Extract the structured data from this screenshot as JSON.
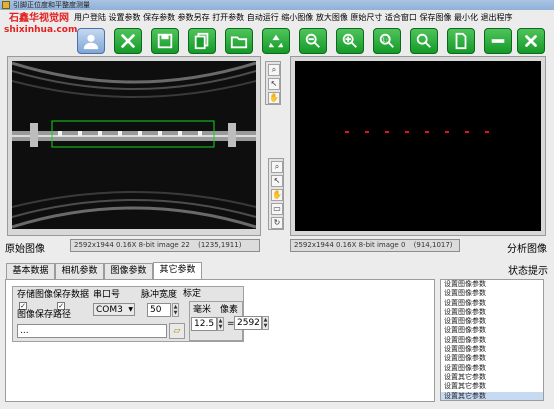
{
  "window": {
    "title": "引脚正位度和平整度测量"
  },
  "logo": {
    "line1": "石鑫华视觉网",
    "line2": "shixinhua.com"
  },
  "toolbar": {
    "labels": [
      "用户登陆",
      "设置参数",
      "保存参数",
      "参数另存",
      "打开参数",
      "自动运行",
      "缩小图像",
      "放大图像",
      "原始尺寸",
      "适合窗口",
      "保存图像",
      "最小化",
      "退出程序"
    ],
    "icons": [
      "user-icon",
      "tools-icon",
      "save-icon",
      "copy-icon",
      "folder-icon",
      "recycle-icon",
      "zoom-out-icon",
      "zoom-in-icon",
      "zoom-1to1-icon",
      "zoom-fit-icon",
      "document-icon",
      "minimize-icon",
      "close-icon"
    ],
    "accent_color": "#1fa634"
  },
  "left_panel": {
    "caption": "原始图像",
    "status": "2592x1944 0.16X 8-bit image 22",
    "coords": "(1235,1911)"
  },
  "right_panel": {
    "caption": "分析图像",
    "status": "2592x1944 0.16X 8-bit image 0",
    "coords": "(914,1017)"
  },
  "tabs": [
    "基本数据",
    "相机参数",
    "图像参数",
    "其它参数"
  ],
  "active_tab": "其它参数",
  "params": {
    "save_image_label": "存储图像",
    "save_data_label": "保存数据",
    "save_image_checked": true,
    "save_data_checked": true,
    "port_label": "串口号",
    "port_value": "COM3",
    "pulse_label": "脉冲宽度",
    "pulse_value": "50",
    "image_path_label": "图像保存路径",
    "image_path_value": "...",
    "calib_label": "标定",
    "mm_label": "毫米",
    "mm_value": "12.5",
    "eq_sign": "=",
    "px_label": "像素",
    "px_value": "2592"
  },
  "status_panel": {
    "title": "状态提示",
    "items": [
      "设置图像参数",
      "设置图像参数",
      "设置图像参数",
      "设置图像参数",
      "设置图像参数",
      "设置图像参数",
      "设置图像参数",
      "设置图像参数",
      "设置图像参数",
      "设置图像参数",
      "设置其它参数",
      "设置其它参数",
      "设置其它参数"
    ],
    "selected_index": 12
  }
}
